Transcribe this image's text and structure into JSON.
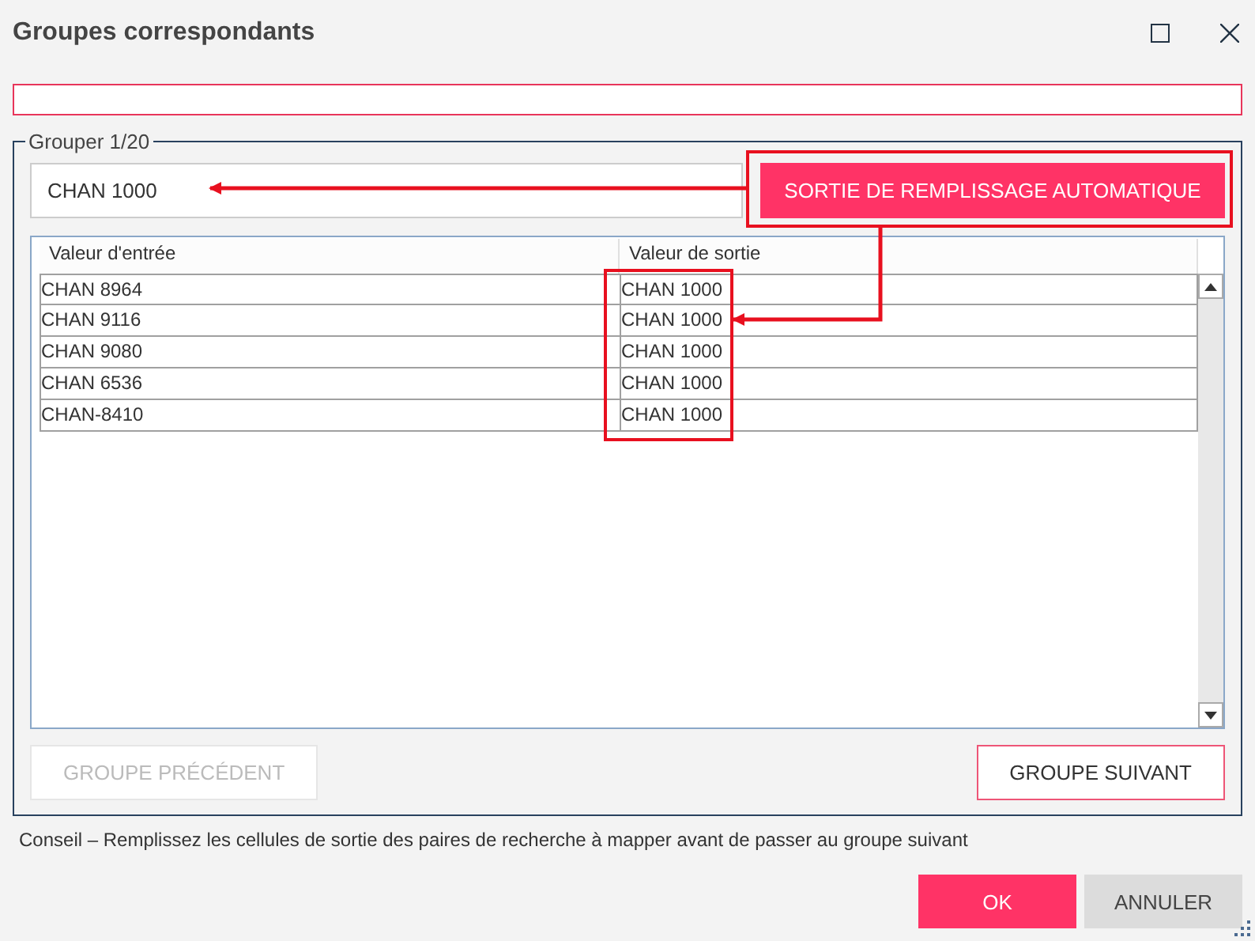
{
  "window": {
    "title": "Groupes correspondants"
  },
  "group": {
    "legend": "Grouper 1/20",
    "output_value": "CHAN 1000",
    "autofill_button": "SORTIE DE REMPLISSAGE AUTOMATIQUE",
    "table": {
      "columns": [
        "Valeur d'entrée",
        "Valeur de sortie"
      ],
      "rows": [
        [
          "CHAN 8964",
          "CHAN 1000"
        ],
        [
          "CHAN 9116",
          "CHAN 1000"
        ],
        [
          "CHAN 9080",
          "CHAN 1000"
        ],
        [
          "CHAN 6536",
          "CHAN 1000"
        ],
        [
          "CHAN-8410",
          "CHAN 1000"
        ]
      ]
    },
    "nav_buttons": [
      {
        "label": "GROUPE PRÉCÉDENT",
        "disabled": true
      },
      {
        "label": "GROUPE SUIVANT",
        "disabled": false
      }
    ]
  },
  "hint": "Conseil – Remplissez les cellules de sortie des paires de recherche à mapper avant de passer au groupe suivant",
  "actions": [
    {
      "label": "OK",
      "kind": "primary"
    },
    {
      "label": "ANNULER",
      "kind": "secondary"
    }
  ]
}
